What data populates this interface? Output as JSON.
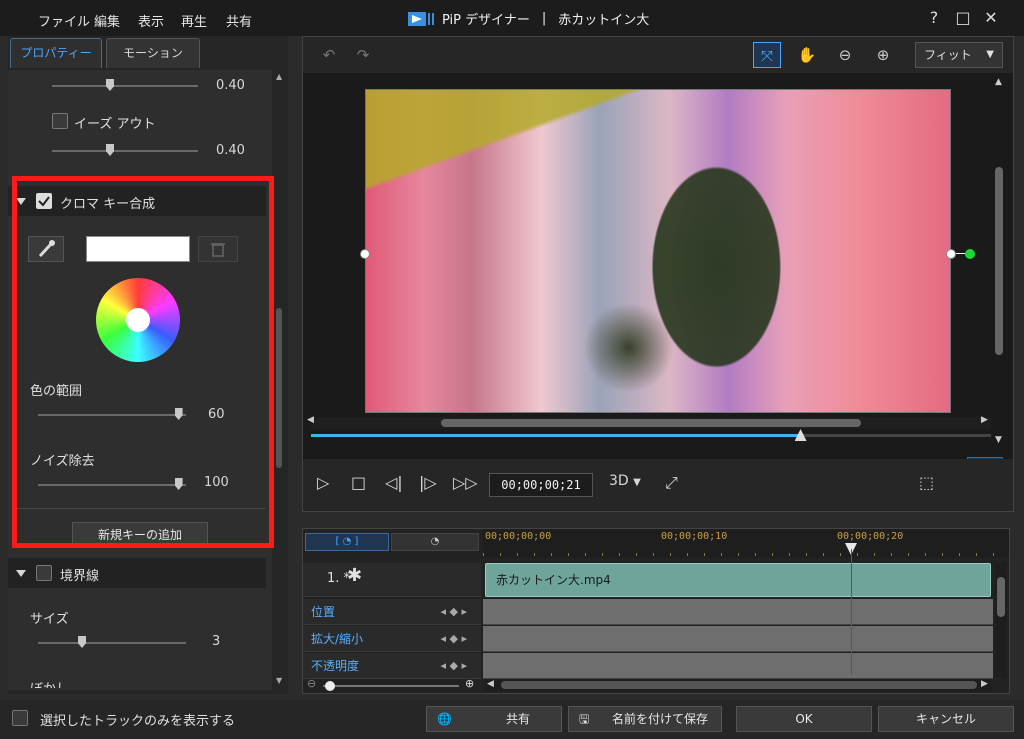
{
  "menu": [
    "ファイル",
    "編集",
    "表示",
    "再生",
    "共有"
  ],
  "title": {
    "app": "PiP デザイナー",
    "separator": "|",
    "doc": "赤カットイン大"
  },
  "window_buttons": {
    "help": "?",
    "maximize": "□",
    "close": "✕"
  },
  "tabs": {
    "properties": "プロパティー",
    "motion": "モーション"
  },
  "ease": {
    "value_top": "0.40",
    "ease_out_label": "イーズ アウト",
    "value_bottom": "0.40"
  },
  "chroma": {
    "header": "クロマ キー合成",
    "color_range_label": "色の範囲",
    "color_range_value": "60",
    "color_range_fraction": 0.95,
    "noise_label": "ノイズ除去",
    "noise_value": "100",
    "noise_fraction": 0.95,
    "add_key_label": "新規キーの追加"
  },
  "border": {
    "header": "境界線",
    "size_label": "サイズ",
    "size_value": "3",
    "blur_label": "ぼかし"
  },
  "preview_toolbar": {
    "undo": "↶",
    "redo": "↷",
    "fit_label": "フィット"
  },
  "playback": {
    "timecode": "00;00;00;21",
    "mode_3d": "3D",
    "seek_fraction": 0.72
  },
  "timeline": {
    "ruler": [
      "00;00;00;00",
      "00;00;00;10",
      "00;00;00;20"
    ],
    "track_name": "1. *",
    "clip_name": "赤カットイン大.mp4",
    "rows": [
      "位置",
      "拡大/縮小",
      "不透明度"
    ]
  },
  "footer": {
    "show_selected_label": "選択したトラックのみを表示する",
    "share_label": "共有",
    "save_as_label": "名前を付けて保存",
    "ok_label": "OK",
    "cancel_label": "キャンセル"
  },
  "colors": {
    "accent": "#4ea4ff",
    "highlight": "#ff1a1a",
    "clip": "#6fa49a",
    "playhead": "#e02020"
  }
}
